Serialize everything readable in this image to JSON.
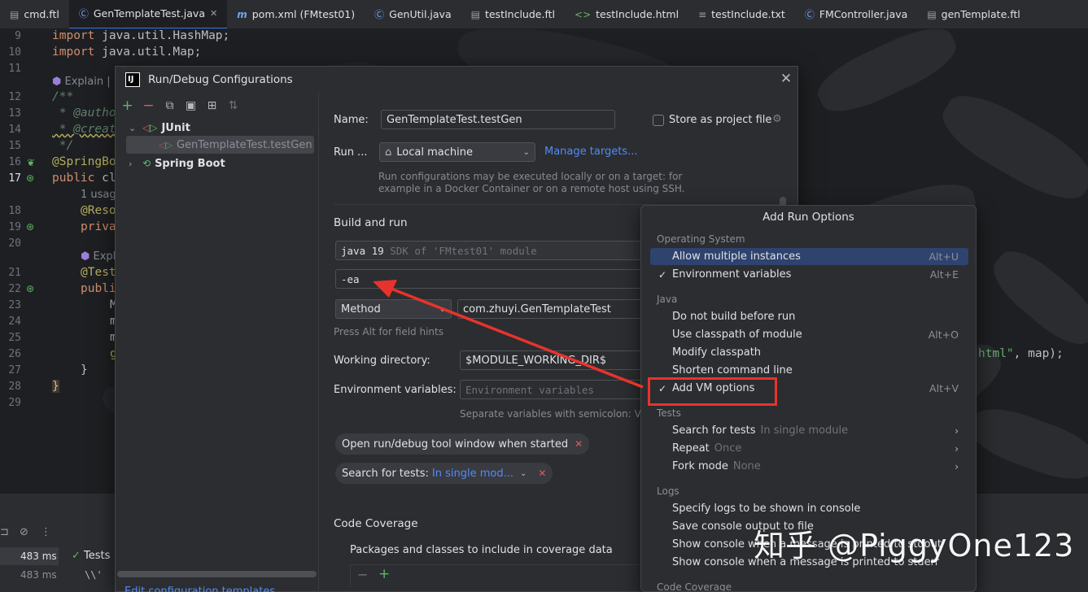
{
  "tabs": [
    {
      "icon": "ftl-file-icon",
      "label": "cmd.ftl"
    },
    {
      "icon": "java-class-icon",
      "label": "GenTemplateTest.java",
      "active": true
    },
    {
      "icon": "maven-icon",
      "label": "pom.xml (FMtest01)"
    },
    {
      "icon": "java-class-icon",
      "label": "GenUtil.java"
    },
    {
      "icon": "ftl-file-icon",
      "label": "testInclude.ftl"
    },
    {
      "icon": "html-file-icon",
      "label": "testInclude.html"
    },
    {
      "icon": "text-file-icon",
      "label": "testInclude.txt"
    },
    {
      "icon": "java-class-icon",
      "label": "FMController.java"
    },
    {
      "icon": "ftl-file-icon",
      "label": "genTemplate.ftl"
    }
  ],
  "editor": {
    "line_numbers": [
      "9",
      "10",
      "11",
      "",
      "12",
      "13",
      "14",
      "15",
      "16",
      "17",
      "",
      "18",
      "19",
      "20",
      "",
      "21",
      "22",
      "23",
      "24",
      "25",
      "26",
      "27",
      "28",
      "29"
    ],
    "line_import1_kw": "import",
    "line_import1_rest": " java.util.HashMap;",
    "line_import2_kw": "import",
    "line_import2_rest": " java.util.Map;",
    "explain_hint": "Explain |",
    "doc_open": "/**",
    "doc_author": " * @autho",
    "doc_create": " * @creat",
    "doc_close": " */",
    "annotation_springboot": "@SpringBo",
    "public_class_kw": "public",
    "public_class_rest": " cl",
    "usage_hint": "1 usag",
    "annotation_resource": "@Reso",
    "private_kw": "priva",
    "explain_hint2": "Expl",
    "annotation_test": "@Test",
    "public_method_kw": "publi",
    "line23": "M",
    "line24": "m",
    "line25": "m",
    "line26": "g",
    "right_code_str": "html\"",
    "right_code_rest": ", map);",
    "brace_inner": "}",
    "brace_outer": "}"
  },
  "bottom_panel": {
    "time1": "483 ms",
    "time2": "483 ms",
    "tests_label": "Tests",
    "code_fragment": "\\\\'"
  },
  "dialog": {
    "title": "Run/Debug Configurations",
    "logo_text": "IJ",
    "left": {
      "tree": [
        {
          "label": "JUnit",
          "expanded": true
        },
        {
          "label": "GenTemplateTest.testGen",
          "selected": true
        },
        {
          "label": "Spring Boot",
          "expanded": false
        }
      ],
      "edit_templates_link": "Edit configuration templates..."
    },
    "right": {
      "name_label": "Name:",
      "name_value": "GenTemplateTest.testGen",
      "store_label": "Store as project file",
      "run_on_label": "Run ...",
      "run_on_value": "Local machine",
      "manage_targets": "Manage targets...",
      "run_hint_1": "Run configurations may be executed locally or on a target: for",
      "run_hint_2": "example in a Docker Container or on a remote host using SSH.",
      "build_run_header": "Build and run",
      "sdk_value": "java 19",
      "sdk_hint": "SDK of 'FMtest01' module",
      "vm_options_value": "-ea",
      "test_kind": "Method",
      "class_value": "com.zhuyi.GenTemplateTest",
      "field_hints": "Press Alt for field hints",
      "working_dir_label": "Working directory:",
      "working_dir_value": "$MODULE_WORKING_DIR$",
      "env_label": "Environment variables:",
      "env_placeholder": "Environment variables",
      "env_hint": "Separate variables with semicolon: VAR",
      "chip_open_tool": "Open run/debug tool window when started",
      "chip_search_label": "Search for tests:",
      "chip_search_value": "In single mod...",
      "code_coverage_header": "Code Coverage",
      "coverage_packages": "Packages and classes to include in coverage data"
    }
  },
  "popup": {
    "title": "Add Run Options",
    "groups": {
      "os": "Operating System",
      "java": "Java",
      "tests": "Tests",
      "logs": "Logs",
      "coverage": "Code Coverage"
    },
    "os_items": [
      {
        "label": "Allow multiple instances",
        "shortcut": "Alt+U",
        "checked": false,
        "highlighted": true
      },
      {
        "label": "Environment variables",
        "shortcut": "Alt+E",
        "checked": true
      }
    ],
    "java_items": [
      {
        "label": "Do not build before run",
        "shortcut": ""
      },
      {
        "label": "Use classpath of module",
        "shortcut": "Alt+O"
      },
      {
        "label": "Modify classpath",
        "shortcut": ""
      },
      {
        "label": "Shorten command line",
        "shortcut": ""
      },
      {
        "label": "Add VM options",
        "shortcut": "Alt+V",
        "checked": true
      }
    ],
    "tests_items": [
      {
        "label": "Search for tests",
        "sub": "In single module"
      },
      {
        "label": "Repeat",
        "sub": "Once"
      },
      {
        "label": "Fork mode",
        "sub": "None"
      }
    ],
    "logs_items": [
      {
        "label": "Specify logs to be shown in console"
      },
      {
        "label": "Save console output to file"
      },
      {
        "label": "Show console when a message is printed to stdout"
      },
      {
        "label": "Show console when a message is printed to stderr"
      }
    ],
    "check_mark": "✓"
  },
  "watermark": "知乎 @PiggyOne123",
  "colors": {
    "accent": "#3574f0",
    "link": "#548af7",
    "annotation_red": "#e8332c",
    "highlight": "#2e436e"
  }
}
